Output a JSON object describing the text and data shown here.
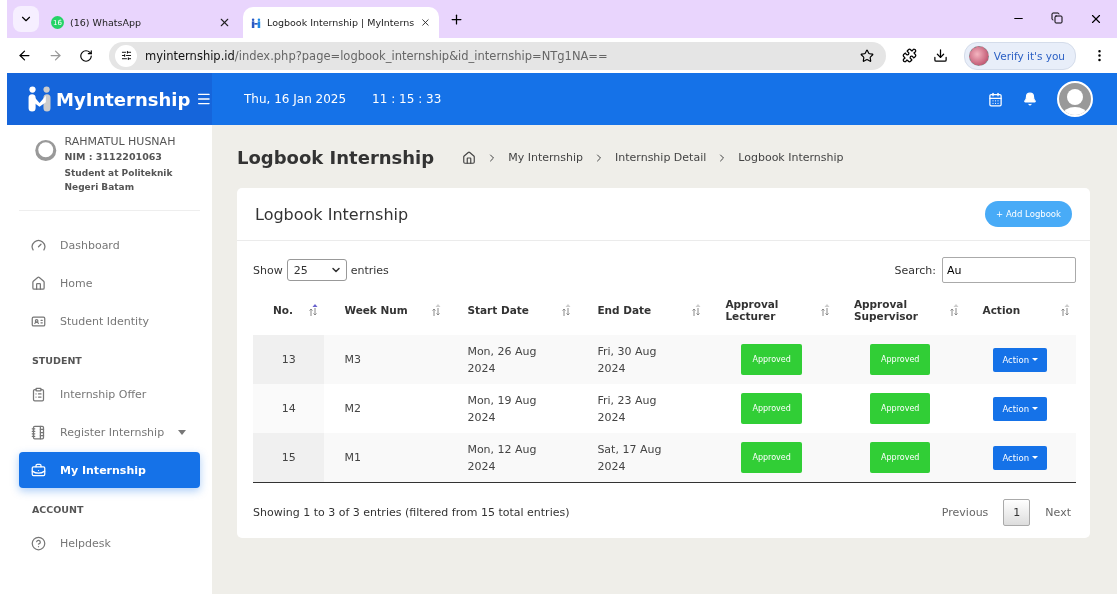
{
  "browser": {
    "tabs": [
      {
        "title": "(16) WhatsApp",
        "badge": "16",
        "kind": "whatsapp",
        "selected": false
      },
      {
        "title": "Logbook Internship | MyInterns",
        "kind": "site",
        "selected": true
      }
    ],
    "address": {
      "host": "myinternship.id",
      "path": "/index.php?page=logbook_internship&id_internship=NTg1NA=="
    },
    "profile_button": "Verify it's you"
  },
  "header": {
    "brand": "MyInternship",
    "date": "Thu, 16 Jan 2025",
    "time": "11 : 15 : 33"
  },
  "sidebar": {
    "user": {
      "name": "RAHMATUL HUSNAH",
      "nim": "NIM : 3112201063",
      "role": "Student at Politeknik Negeri Batam"
    },
    "sections": [
      {
        "items": [
          {
            "label": "Dashboard",
            "kind": "link",
            "selected": false
          },
          {
            "label": "Home",
            "kind": "link",
            "selected": false
          },
          {
            "label": "Student Identity",
            "kind": "link",
            "selected": false
          }
        ]
      },
      {
        "heading": "STUDENT",
        "items": [
          {
            "label": "Internship Offer",
            "kind": "link",
            "selected": false
          },
          {
            "label": "Register Internship",
            "kind": "dropdown",
            "selected": false
          },
          {
            "label": "My Internship",
            "kind": "link",
            "selected": true
          }
        ]
      },
      {
        "heading": "ACCOUNT",
        "items": [
          {
            "label": "Helpdesk",
            "kind": "link",
            "selected": false
          }
        ]
      }
    ]
  },
  "page": {
    "title": "Logbook Internship",
    "breadcrumb": [
      "My Internship",
      "Internship Detail",
      "Logbook Internship"
    ]
  },
  "card": {
    "title": "Logbook Internship",
    "add_button": "+ Add Logbook",
    "length": {
      "before": "Show",
      "value": "25",
      "after": "entries"
    },
    "search": {
      "label": "Search:",
      "value": "Au"
    },
    "table": {
      "columns": [
        {
          "label": "No.",
          "sorted": true
        },
        {
          "label": "Week Num",
          "sorted": false
        },
        {
          "label": "Start Date",
          "sorted": false
        },
        {
          "label": "End Date",
          "sorted": false
        },
        {
          "label": "Approval Lecturer",
          "sorted": false
        },
        {
          "label": "Approval Supervisor",
          "sorted": false
        },
        {
          "label": "Action",
          "sorted": false
        }
      ],
      "rows": [
        {
          "no": "13",
          "week": "M3",
          "start": "Mon, 26 Aug 2024",
          "end": "Fri, 30 Aug 2024",
          "lecturer": "Approved",
          "supervisor": "Approved",
          "action": "Action"
        },
        {
          "no": "14",
          "week": "M2",
          "start": "Mon, 19 Aug 2024",
          "end": "Fri, 23 Aug 2024",
          "lecturer": "Approved",
          "supervisor": "Approved",
          "action": "Action"
        },
        {
          "no": "15",
          "week": "M1",
          "start": "Mon, 12 Aug 2024",
          "end": "Sat, 17 Aug 2024",
          "lecturer": "Approved",
          "supervisor": "Approved",
          "action": "Action"
        }
      ]
    },
    "info": "Showing 1 to 3 of 3 entries (filtered from 15 total entries)",
    "pagination": [
      {
        "label": "Previous",
        "kind": "nav",
        "selected": false
      },
      {
        "label": "1",
        "kind": "page",
        "selected": true
      },
      {
        "label": "Next",
        "kind": "nav",
        "selected": false
      }
    ]
  }
}
